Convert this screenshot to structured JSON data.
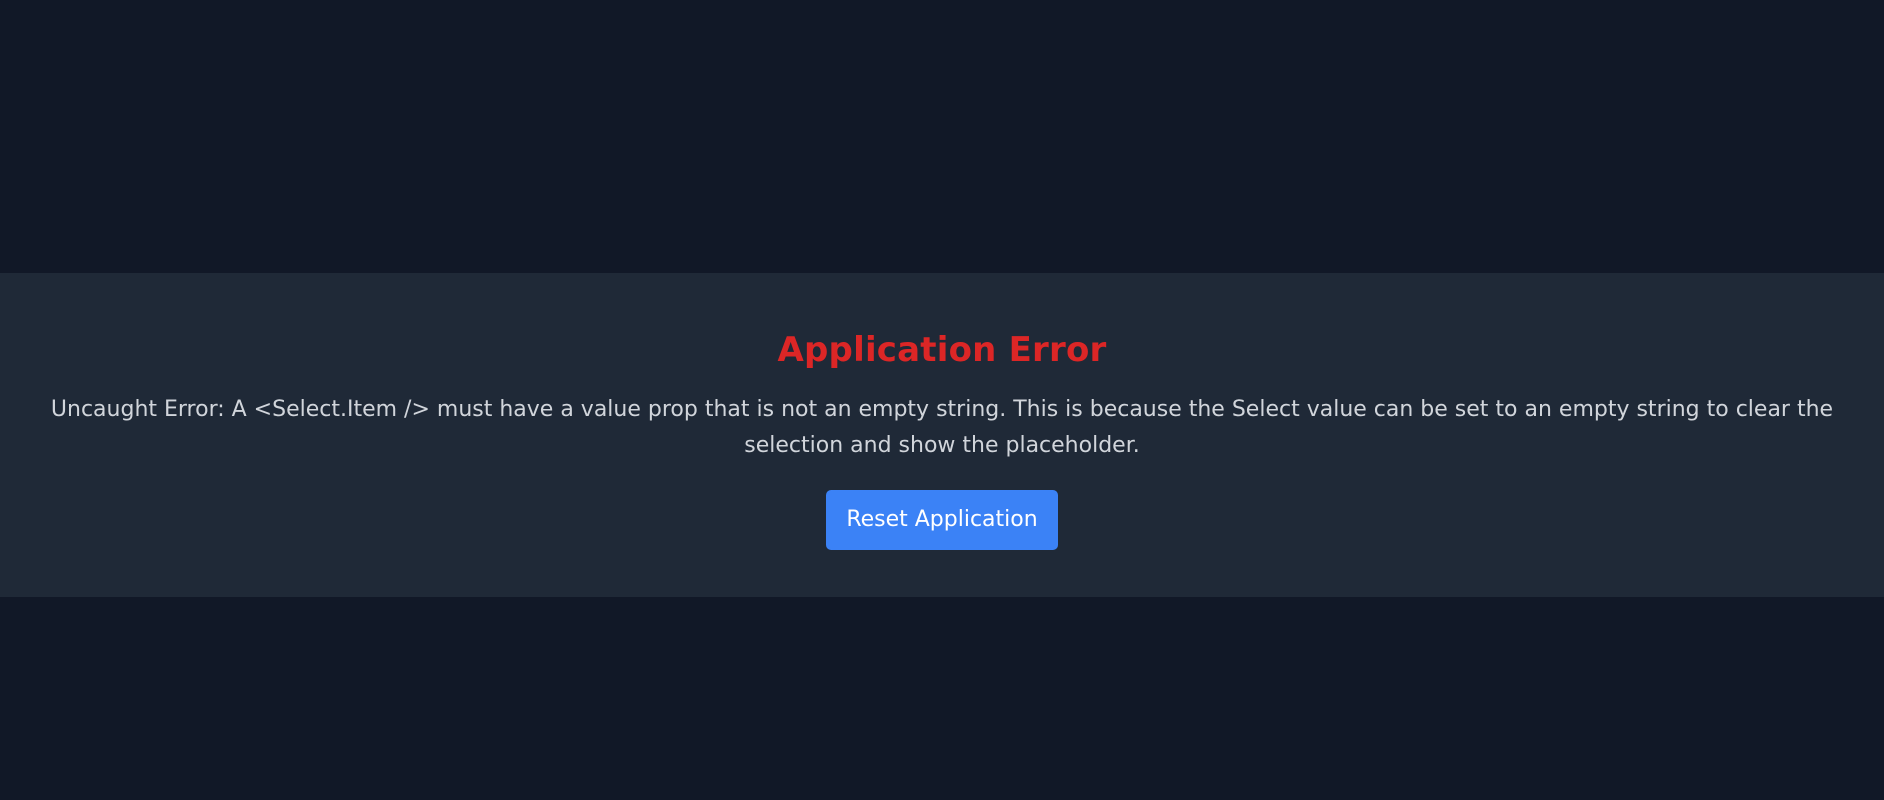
{
  "error_panel": {
    "title": "Application Error",
    "message": "Uncaught Error: A <Select.Item /> must have a value prop that is not an empty string. This is because the Select value can be set to an empty string to clear the selection and show the placeholder.",
    "reset_button_label": "Reset Application"
  },
  "colors": {
    "page_background": "#111827",
    "panel_background": "#1f2937",
    "title": "#dc2626",
    "message_text": "#d1d5db",
    "button_background": "#3b82f6",
    "button_text": "#ffffff"
  }
}
